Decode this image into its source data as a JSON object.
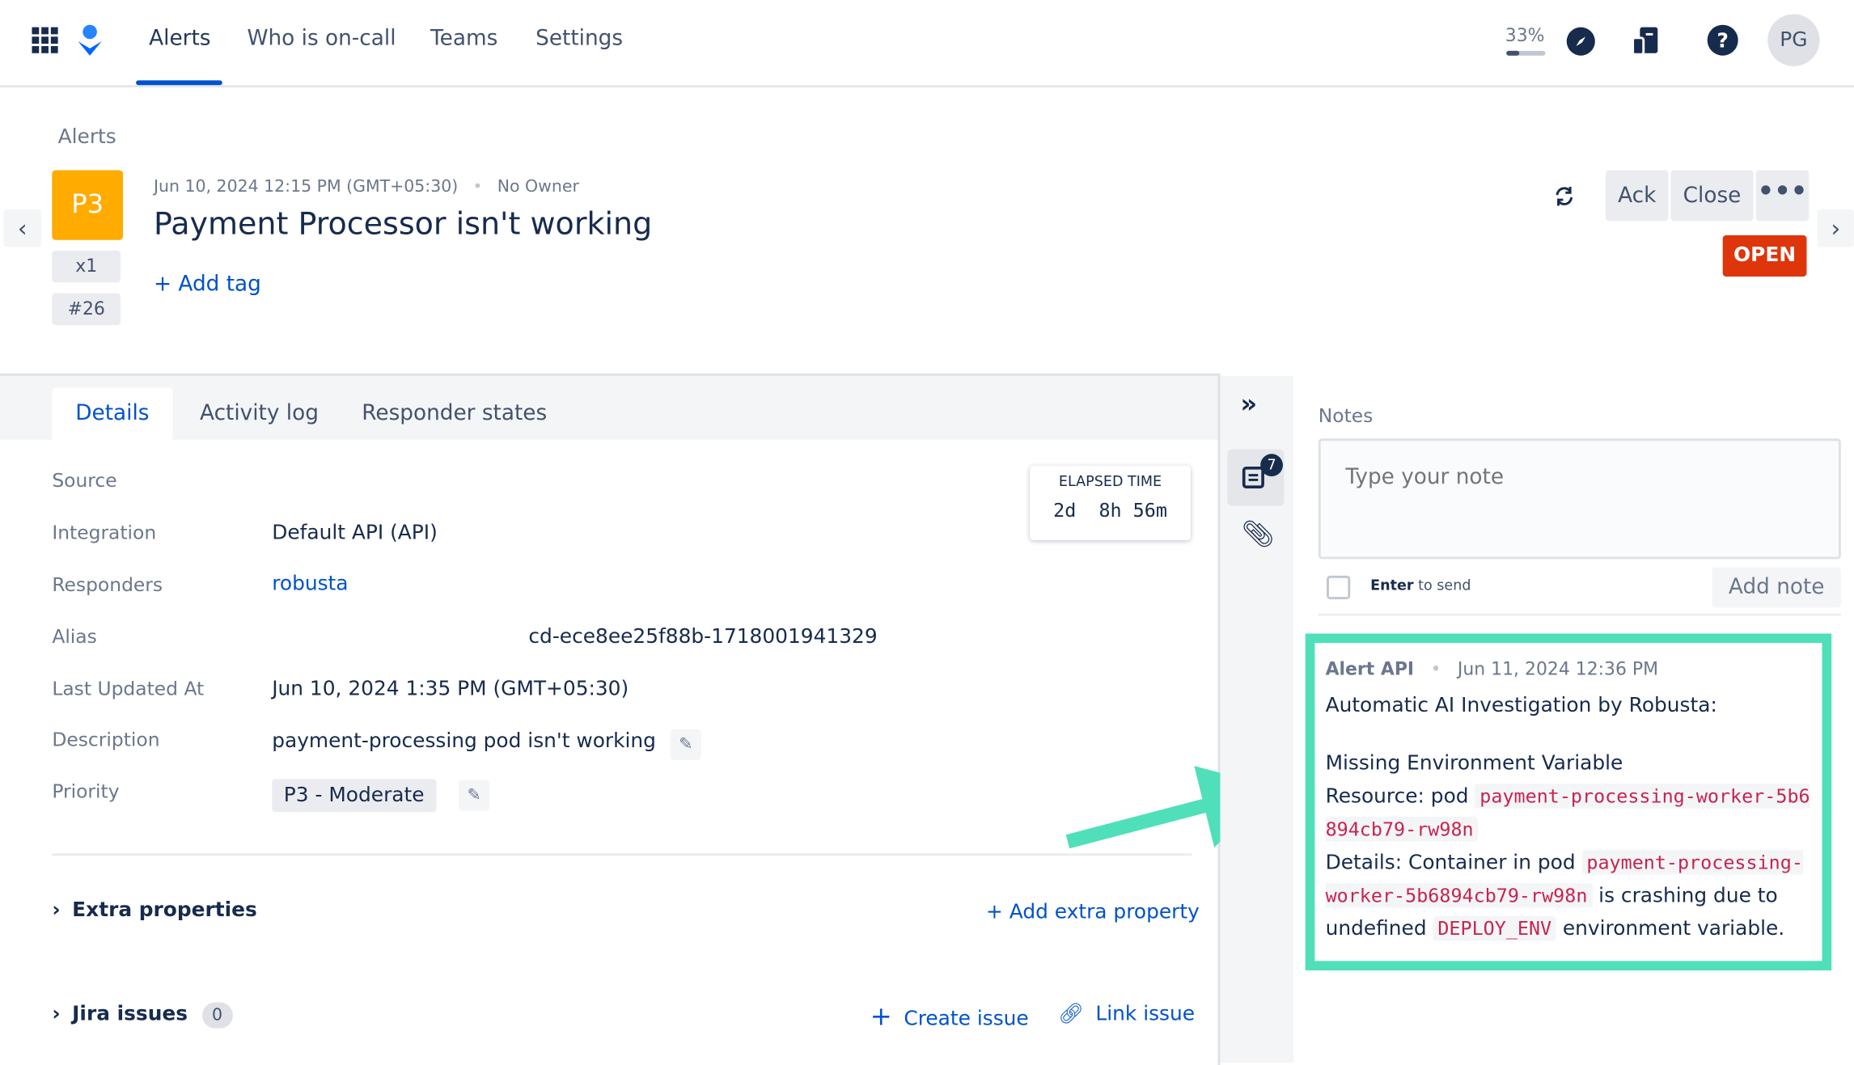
{
  "topbar": {
    "nav": [
      "Alerts",
      "Who is on-call",
      "Teams",
      "Settings"
    ],
    "progress_label": "33%",
    "progress": 0.33,
    "avatar": "PG"
  },
  "header": {
    "breadcrumb": "Alerts",
    "priority": "P3",
    "count": "x1",
    "number": "#26",
    "timestamp": "Jun 10, 2024 12:15 PM (GMT+05:30)",
    "owner": "No Owner",
    "title": "Payment Processor isn't working",
    "add_tag": "+ Add tag",
    "ack": "Ack",
    "close": "Close",
    "status": "OPEN",
    "colors": {
      "priority": "#ffab00",
      "status": "#de350b"
    }
  },
  "tabs": [
    "Details",
    "Activity log",
    "Responder states"
  ],
  "elapsed": {
    "label": "ELAPSED TIME",
    "value": "2d  8h 56m"
  },
  "details": {
    "source_label": "Source",
    "integration_label": "Integration",
    "integration": "Default API (API)",
    "responders_label": "Responders",
    "responders": "robusta",
    "alias_label": "Alias",
    "alias": "cd-ece8ee25f88b-1718001941329",
    "updated_label": "Last Updated At",
    "updated": "Jun 10, 2024 1:35 PM (GMT+05:30)",
    "description_label": "Description",
    "description": "payment-processing pod isn't working",
    "priority_label": "Priority",
    "priority": "P3 - Moderate"
  },
  "sections": {
    "extra": "Extra properties",
    "add_extra": "+ Add extra property",
    "jira": "Jira issues",
    "jira_count": "0",
    "create_issue": "Create issue",
    "link_issue": "Link issue"
  },
  "sidebar": {
    "notes_badge": "7"
  },
  "notes": {
    "title": "Notes",
    "placeholder": "Type your note",
    "enter_bold": "Enter",
    "enter_rest": " to send",
    "add_note": "Add note",
    "note": {
      "author": "Alert API",
      "time": "Jun 11, 2024 12:36 PM",
      "line1": "Automatic AI Investigation by Robusta:",
      "line2": "Missing Environment Variable",
      "res_prefix": "Resource: pod ",
      "pod": "payment-processing-worker-5b6894cb79-rw98n",
      "det_prefix": "Details: Container in pod ",
      "det_mid": " is crashing due to undefined ",
      "env": "DEPLOY_ENV",
      "det_end": " environment variable."
    },
    "highlight_color": "#4fe0b9"
  }
}
